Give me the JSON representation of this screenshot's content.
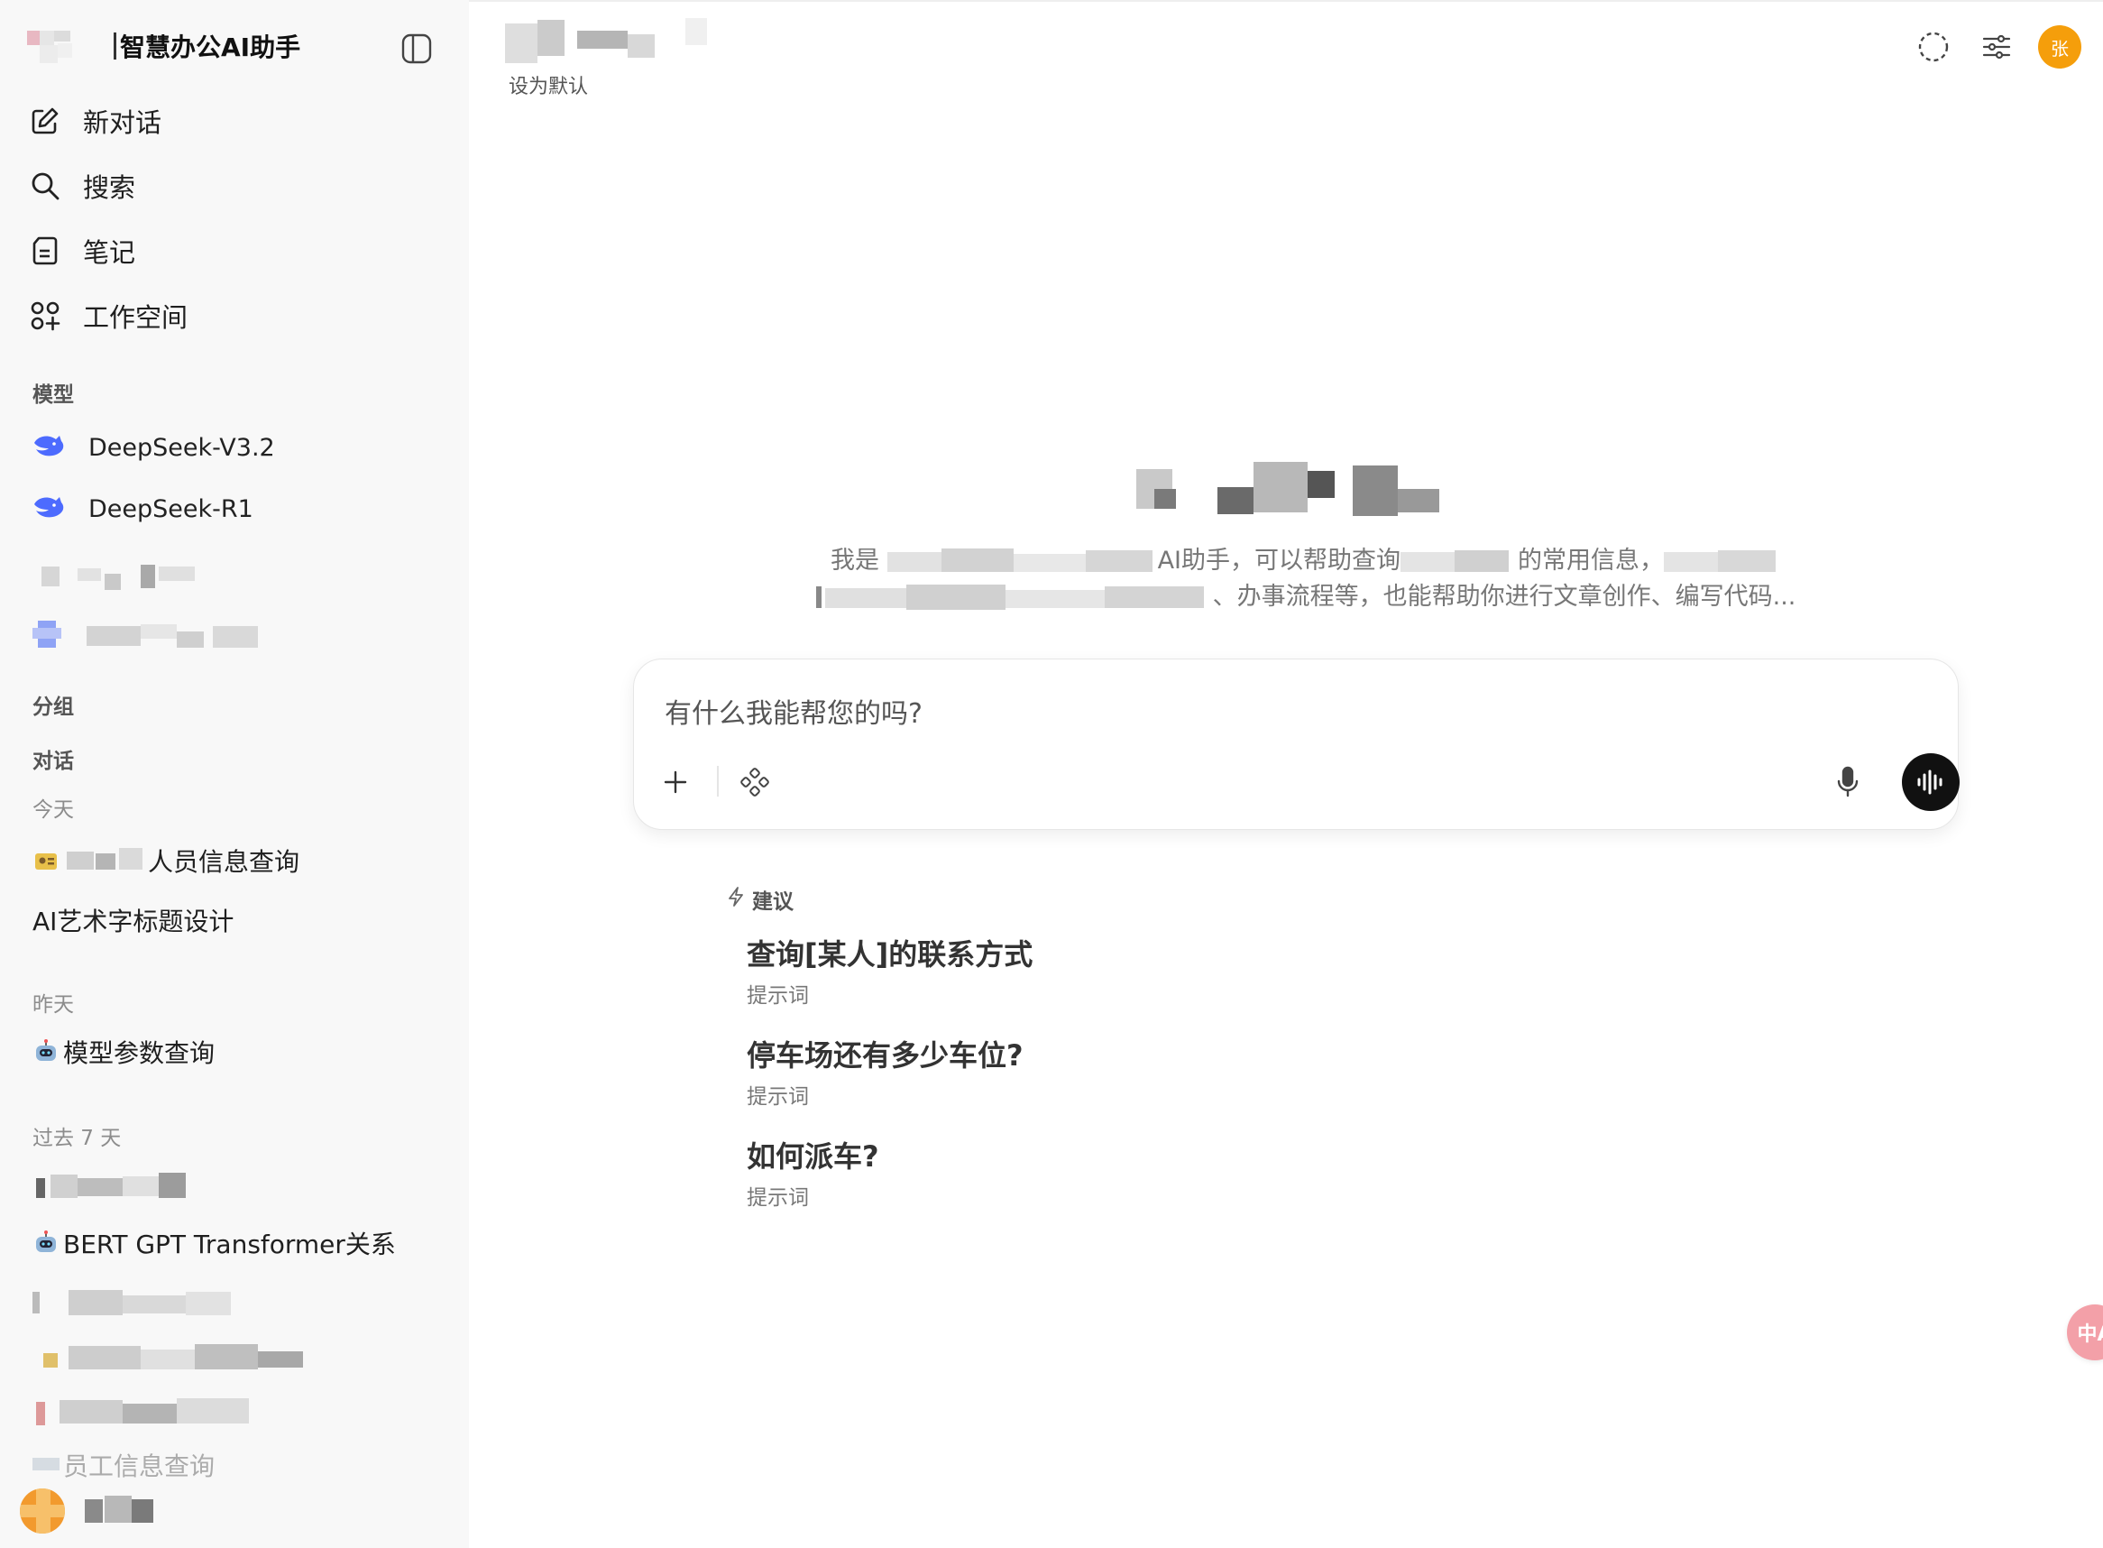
{
  "app": {
    "title": "智慧办公AI助手"
  },
  "sidebar": {
    "nav": [
      {
        "label": "新对话",
        "icon": "edit-icon"
      },
      {
        "label": "搜索",
        "icon": "search-icon"
      },
      {
        "label": "笔记",
        "icon": "note-icon"
      },
      {
        "label": "工作空间",
        "icon": "workspace-icon"
      }
    ],
    "models_heading": "模型",
    "models": [
      {
        "label": "DeepSeek-V3.2",
        "icon": "whale-icon"
      },
      {
        "label": "DeepSeek-R1",
        "icon": "whale-icon"
      }
    ],
    "groups_heading": "分组",
    "chats_heading": "对话",
    "today_heading": "今天",
    "today": [
      {
        "label": "人员信息查询",
        "icon": "user-card-icon"
      },
      {
        "label": "AI艺术字标题设计"
      }
    ],
    "yesterday_heading": "昨天",
    "yesterday": [
      {
        "label": "模型参数查询",
        "icon": "robot-icon"
      }
    ],
    "past7_heading": "过去 7 天",
    "past7": [
      {
        "label": "BERT GPT Transformer关系",
        "icon": "robot-icon"
      },
      {
        "label": "员工信息查询"
      }
    ]
  },
  "header": {
    "set_default": "设为默认",
    "avatar_initial": "张"
  },
  "welcome": {
    "line1_a": "我是",
    "line1_b": "AI助手，可以帮助查询",
    "line1_c": "的常用信息，",
    "line2_a": "、办事流程等，也能帮助你进行文章创作、编写代码..."
  },
  "composer": {
    "placeholder": "有什么我能帮您的吗?"
  },
  "suggestions": {
    "heading": "建议",
    "items": [
      {
        "title": "查询[某人]的联系方式",
        "subtitle": "提示词"
      },
      {
        "title": "停车场还有多少车位?",
        "subtitle": "提示词"
      },
      {
        "title": "如何派车?",
        "subtitle": "提示词"
      }
    ]
  },
  "translate_fab": {
    "label": "中A"
  }
}
